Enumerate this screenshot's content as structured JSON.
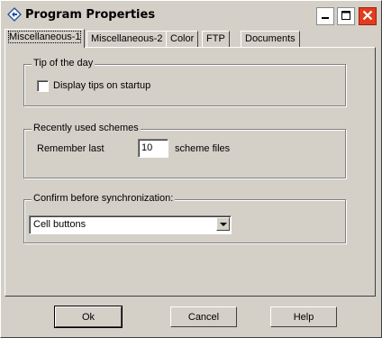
{
  "window": {
    "title": "Program Properties",
    "app_icon": "diamond-arrows-icon"
  },
  "titlebar_buttons": {
    "minimize_icon": "minimize-icon",
    "maximize_icon": "maximize-icon",
    "close_icon": "close-icon"
  },
  "tabs": [
    {
      "label": "Miscellaneous-1",
      "active": true
    },
    {
      "label": "Miscellaneous-2",
      "active": false
    },
    {
      "label": "Color",
      "active": false
    },
    {
      "label": "FTP",
      "active": false
    },
    {
      "label": "Documents",
      "active": false
    }
  ],
  "tip_group": {
    "legend": "Tip of the day",
    "checkbox_label": "Display tips on startup",
    "checked": false
  },
  "schemes_group": {
    "legend": "Recently used schemes",
    "prefix_label": "Remember last",
    "value": "10",
    "suffix_label": "scheme files"
  },
  "sync_group": {
    "legend": "Confirm before synchronization:",
    "selected": "Cell buttons"
  },
  "buttons": {
    "ok": "Ok",
    "cancel": "Cancel",
    "help": "Help"
  },
  "colors": {
    "face": "#d4d0c8",
    "close_button": "#e23c1e"
  }
}
